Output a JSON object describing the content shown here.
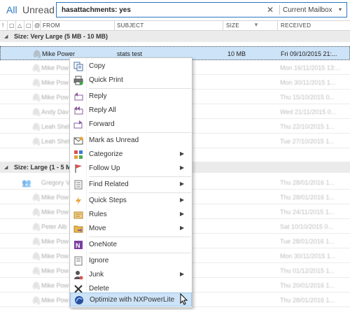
{
  "filters": {
    "all": "All",
    "unread": "Unread"
  },
  "search": {
    "query": "hasattachments: yes",
    "clear": "✕",
    "scope": "Current Mailbox"
  },
  "columns": {
    "from": "FROM",
    "subject": "SUBJECT",
    "size": "SIZE",
    "received": "RECEIVED"
  },
  "groups": [
    {
      "title": "Size: Very Large (5 MB - 10 MB)"
    },
    {
      "title": "Size: Large (1 - 5 M"
    }
  ],
  "rows_group1": [
    {
      "from": "Mike Power",
      "subject": "stats test",
      "size": "10 MB",
      "received": "Fri 09/10/2015 21:..."
    },
    {
      "from": "Mike Pow",
      "subject": "",
      "size": "",
      "received": "Mon 16/11/2015 13:..."
    },
    {
      "from": "Mike Pow",
      "subject": "",
      "size": "",
      "received": "Mon 30/11/2015 1..."
    },
    {
      "from": "Mike Pow",
      "subject": "",
      "size": "",
      "received": "Thu 15/10/2015 0..."
    },
    {
      "from": "Andy Dav",
      "subject": "",
      "size": "",
      "received": "Wed 21/11/2015 0..."
    },
    {
      "from": "Leah Shel",
      "subject": "",
      "size": "",
      "received": "Thu 22/10/2015 1..."
    },
    {
      "from": "Leah Shel",
      "subject": "",
      "size": "",
      "received": "Tue 27/10/2015 1..."
    }
  ],
  "rows_group2": [
    {
      "from": "Gregory V",
      "subject": "",
      "size": "",
      "received": "Thu 28/01/2016 1..."
    },
    {
      "from": "Mike Pow",
      "subject": "",
      "size": "",
      "received": "Thu 28/01/2016 1..."
    },
    {
      "from": "Mike Pow",
      "subject": "",
      "size": "",
      "received": "Thu 24/11/2015 1..."
    },
    {
      "from": "Peter Alb",
      "subject": "",
      "size": "",
      "received": "Sat 10/10/2015 0..."
    },
    {
      "from": "Mike Pow",
      "subject": "",
      "size": "",
      "received": "Tue 28/01/2016 1..."
    },
    {
      "from": "Mike Pow",
      "subject": "",
      "size": "",
      "received": "Mon 30/11/2015 1..."
    },
    {
      "from": "Mike Pow",
      "subject": "",
      "size": "",
      "received": "Thu 01/12/2015 1..."
    },
    {
      "from": "Mike Pow",
      "subject": "",
      "size": "",
      "received": "Thu 20/01/2016 1..."
    },
    {
      "from": "Mike Pow",
      "subject": "",
      "size": "",
      "received": "Thu 28/01/2016 1..."
    },
    {
      "from": "Mike Pow",
      "subject": "",
      "size": "",
      "received": "Thu 20/01/2016 1..."
    }
  ],
  "menu": {
    "copy": "Copy",
    "quick_print": "Quick Print",
    "reply": "Reply",
    "reply_all": "Reply All",
    "forward": "Forward",
    "mark_unread": "Mark as Unread",
    "categorize": "Categorize",
    "follow_up": "Follow Up",
    "find_related": "Find Related",
    "quick_steps": "Quick Steps",
    "rules": "Rules",
    "move": "Move",
    "onenote": "OneNote",
    "ignore": "Ignore",
    "junk": "Junk",
    "delete": "Delete",
    "nxpowerlite": "Optimize with NXPowerLite"
  },
  "colors": {
    "accent": "#2b79c2",
    "selection": "#cde3f7"
  }
}
